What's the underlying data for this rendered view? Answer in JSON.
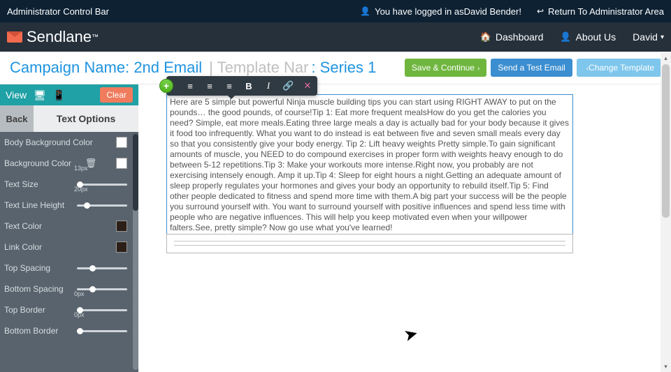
{
  "admin_bar": {
    "title": "Administrator Control Bar",
    "logged_in_prefix": "You have logged in as",
    "user": "David Bender!",
    "return_link": "Return To Administrator Area"
  },
  "brand": {
    "name": "Sendlane"
  },
  "nav": {
    "dashboard": "Dashboard",
    "about": "About Us",
    "user": "David"
  },
  "campaign_bar": {
    "campaign_label": "Campaign Name:",
    "campaign_value": "2nd Email",
    "template_label": "Template Nar",
    "series_label": ": Series 1"
  },
  "actions": {
    "save": "Save & Continue",
    "send_test": "Send a Test Email",
    "change_template": "Change Template"
  },
  "sidebar": {
    "view_label": "View",
    "clear": "Clear",
    "back": "Back",
    "text_options": "Text Options",
    "opts": {
      "body_bg": "Body Background Color",
      "bg": "Background Color",
      "text_size": "Text Size",
      "text_size_val": "13px",
      "line_height": "Text Line Height",
      "line_height_val": "20px",
      "text_color": "Text Color",
      "link_color": "Link Color",
      "top_spacing": "Top Spacing",
      "bottom_spacing": "Bottom Spacing",
      "top_border": "Top Border",
      "top_border_val": "0px",
      "bottom_border": "Bottom Border",
      "bottom_border_val": "0px"
    }
  },
  "toolbar_icons": {
    "align_left": "≡",
    "align_center": "≡",
    "align_right": "≡",
    "bold": "B",
    "italic": "I",
    "link": "🔗",
    "unlink": "✕"
  },
  "editor": {
    "body": "Here are 5 simple but powerful Ninja muscle building tips you can start using RIGHT AWAY to put on the pounds… the good pounds, of course!Tip 1: Eat more frequent mealsHow do you get the calories you need? Simple, eat more meals.Eating three large meals a day is actually bad for your body because it gives it food too infrequently. What you want to do instead is eat between five and seven small meals every day so that you consistently give your body energy. Tip 2: Lift heavy weights Pretty simple.To gain significant amounts of muscle, you NEED to do compound exercises in proper form with weights heavy enough to do between 5-12 repetitions.Tip 3: Make your workouts more intense.Right now, you probably are not exercising intensely enough. Amp it up.Tip 4: Sleep for eight hours a night.Getting an adequate amount of sleep properly regulates your hormones and gives your body an opportunity to rebuild itself.Tip 5: Find other people dedicated to fitness and spend more time with them.A big part your success will be the people you surround yourself with. You want to surround yourself with positive influences and spend less time with people who are negative influences. This will help you keep motivated even when your willpower falters.See, pretty simple? Now go use what you've learned!"
  }
}
